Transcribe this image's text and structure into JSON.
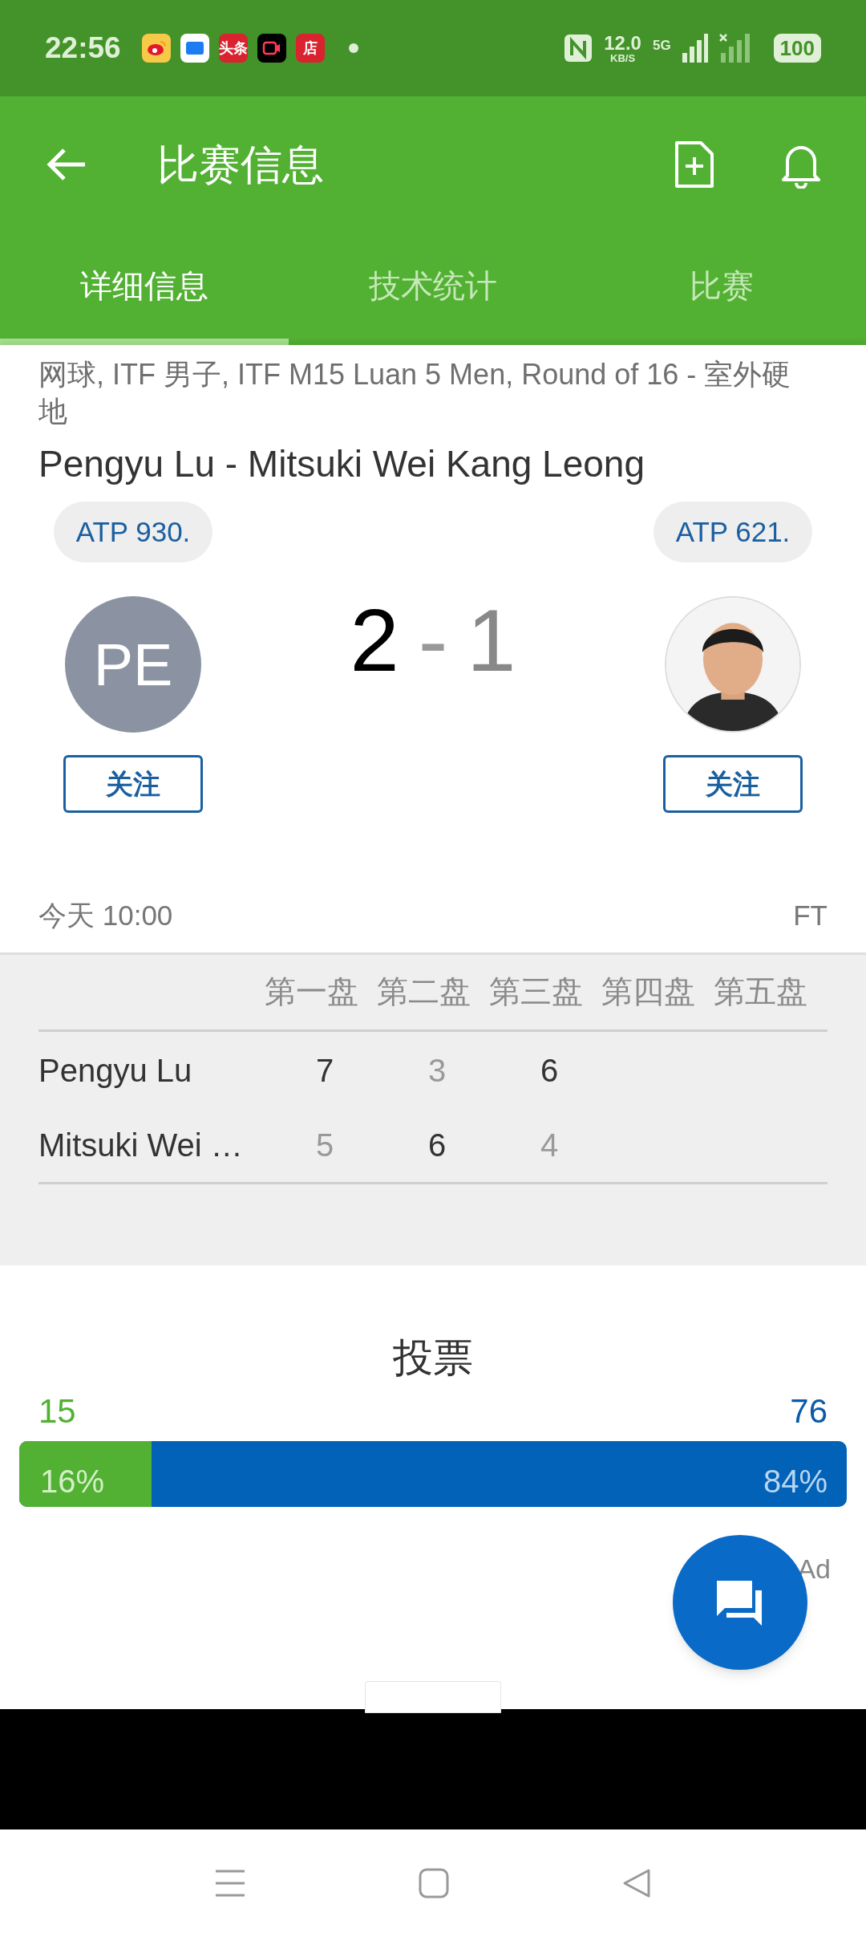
{
  "status_bar": {
    "time": "22:56",
    "notification_icons": [
      {
        "kind": "weibo"
      },
      {
        "kind": "blue"
      },
      {
        "kind": "text",
        "label": "头条"
      },
      {
        "kind": "video"
      },
      {
        "kind": "text",
        "label": "店"
      }
    ],
    "speed": "12.0",
    "speed_unit": "KB/S",
    "network": "5G",
    "battery": "100"
  },
  "app_bar": {
    "title": "比赛信息"
  },
  "tabs": [
    {
      "label": "详细信息",
      "selected": true
    },
    {
      "label": "技术统计",
      "selected": false
    },
    {
      "label": "比赛",
      "selected": false
    }
  ],
  "match": {
    "competition": "网球, ITF 男子, ITF M15 Luan 5 Men, Round of 16 - 室外硬地",
    "title": "Pengyu Lu - Mitsuki Wei Kang Leong",
    "home": {
      "ranking": "ATP 930.",
      "initials": "PE",
      "follow": "关注"
    },
    "away": {
      "ranking": "ATP 621.",
      "kind": "picture",
      "follow": "关注"
    },
    "score_home": "2",
    "score_separator": "-",
    "score_away": "1",
    "home_leading": true,
    "time": "今天 10:00",
    "status": "FT"
  },
  "sets_table": {
    "columns": [
      "第一盘",
      "第二盘",
      "第三盘",
      "第四盘",
      "第五盘"
    ],
    "rows": [
      {
        "player": "Pengyu Lu",
        "scores": [
          {
            "value": "7",
            "won": true
          },
          {
            "value": "3",
            "won": false
          },
          {
            "value": "6",
            "won": true
          }
        ]
      },
      {
        "player": "Mitsuki Wei …",
        "scores": [
          {
            "value": "5",
            "won": false
          },
          {
            "value": "6",
            "won": true
          },
          {
            "value": "4",
            "won": false
          }
        ]
      }
    ]
  },
  "poll": {
    "title": "投票",
    "home_votes": "15",
    "away_votes": "76",
    "home_percent": "16%",
    "away_percent": "84%",
    "level": 0.16
  },
  "ad": {
    "label": "Ad"
  }
}
